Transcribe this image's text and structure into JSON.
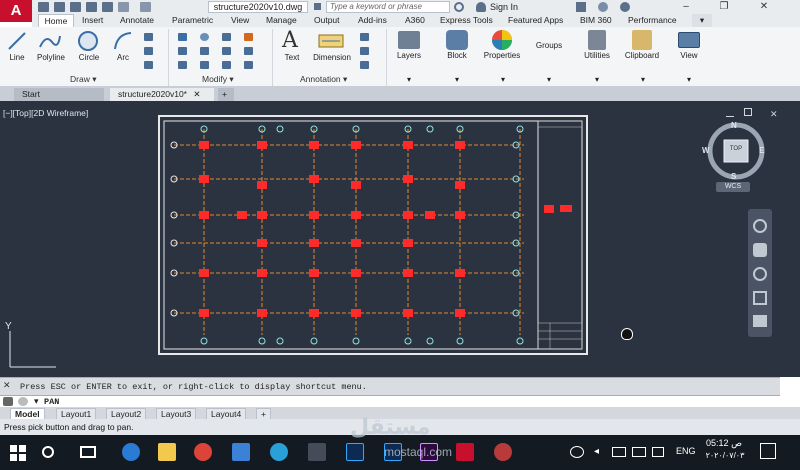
{
  "titlebar": {
    "doc_title": "structure2020v10.dwg",
    "search_placeholder": "Type a keyword or phrase",
    "sign_in": "Sign In"
  },
  "ribbon_tabs": [
    "Home",
    "Insert",
    "Annotate",
    "Parametric",
    "View",
    "Manage",
    "Output",
    "Add-ins",
    "A360",
    "Express Tools",
    "Featured Apps",
    "BIM 360",
    "Performance"
  ],
  "ribbon": {
    "draw_tools": [
      "Line",
      "Polyline",
      "Circle",
      "Arc"
    ],
    "draw_section": "Draw",
    "modify_section": "Modify",
    "annotation_tools": [
      "Text",
      "Dimension"
    ],
    "annotation_section": "Annotation",
    "big_tools": [
      "Layers",
      "Block",
      "Properties",
      "Groups",
      "Utilities",
      "Clipboard",
      "View"
    ]
  },
  "file_tabs": {
    "start": "Start",
    "active": "structure2020v10*",
    "new": "+"
  },
  "viewport": {
    "label": "[−][Top][2D Wireframe]",
    "viewcube": {
      "n": "N",
      "s": "S",
      "e": "E",
      "w": "W",
      "face": "TOP",
      "wcs": "WCS"
    },
    "ucs_y": "Y"
  },
  "command": {
    "history": "Press ESC or ENTER to exit, or right-click to display shortcut menu.",
    "prompt": "PAN"
  },
  "layout_tabs": [
    "Model",
    "Layout1",
    "Layout2",
    "Layout3",
    "Layout4"
  ],
  "layout_add": "+",
  "status": "Press pick button and drag to pan.",
  "taskbar": {
    "lang": "ENG",
    "time": "05:12 ص",
    "date": "٢٠٢٠/٠٧/٠٣"
  },
  "watermark": {
    "arabic": "مستقل",
    "latin": "mostaql.com"
  },
  "colors": {
    "canvas": "#2b3340",
    "grid_line": "#e2872b",
    "column": "#ff2b2b",
    "accent": "#c8102e"
  }
}
